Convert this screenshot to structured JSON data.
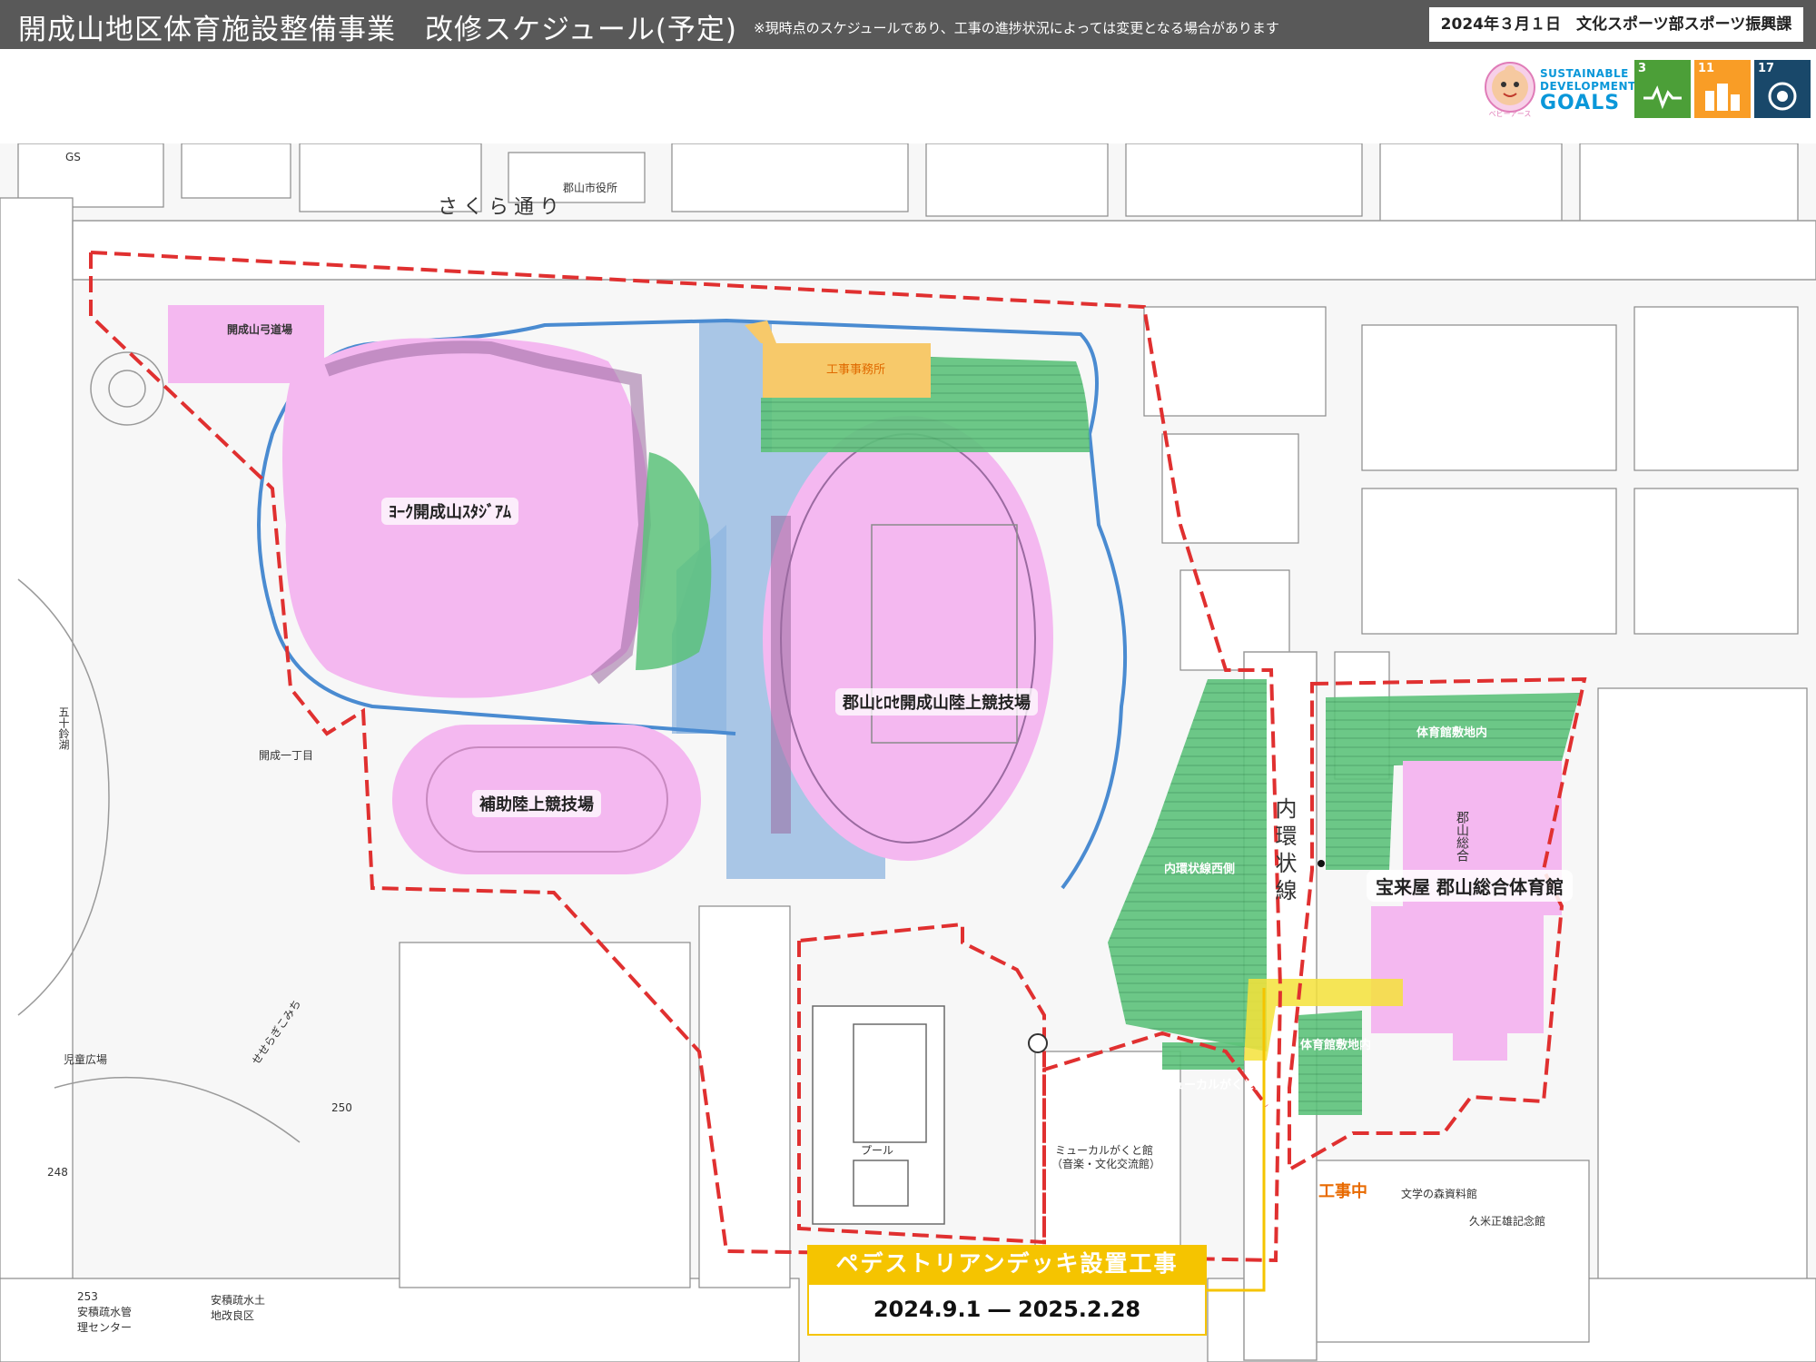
{
  "header": {
    "title": "開成山地区体育施設整備事業　改修スケジュール(予定)",
    "note": "※現時点のスケジュールであり、工事の進捗状況によっては変更となる場合があります",
    "date_dept": "2024年３月１日　文化スポーツ部スポーツ振興課"
  },
  "sdgs": {
    "mascot_caption": "ベビーアース",
    "logo_line1": "SUSTAINABLE",
    "logo_line2": "DEVELOPMENT",
    "logo_line3": "GOALS",
    "tiles": [
      {
        "num": "3",
        "color": "#4c9f38",
        "icon": "heartbeat-icon"
      },
      {
        "num": "11",
        "color": "#f99d26",
        "icon": "city-icon"
      },
      {
        "num": "17",
        "color": "#19486a",
        "icon": "partnership-icon"
      }
    ]
  },
  "map": {
    "roads": {
      "sakura": "さくら通り",
      "naikanjo": "内環状線",
      "seseragi": "せせらぎこみち"
    },
    "landmarks": {
      "city_hall": "郡山市役所",
      "gs": "GS",
      "kaiseiyama_1": "開成一丁目",
      "gojyurin": "五十鈴湖",
      "jido": "児童広場",
      "musical": "ミューカルがくと館",
      "musical_sub": "（音楽・文化交流館）",
      "bungaku": "文学の森資料館",
      "kume": "久米正雄記念館",
      "anzen": "安積疏水管理センター",
      "anzen_num": "253",
      "tochikai": "安積疏水土地改良区",
      "n250": "250",
      "n248": "248",
      "pool": "プール"
    },
    "venues": {
      "kyudo": "開成山弓道場",
      "stadium": "ﾖｰｸ開成山ｽﾀｼﾞｱﾑ",
      "rikujo": "郡山ﾋﾛｾ開成山陸上競技場",
      "hojo": "補助陸上競技場",
      "gym": "宝来屋 郡山総合体育館",
      "gym_bldg": "郡山総合"
    },
    "parking": {
      "office": "工事事務所",
      "naikan_west": "内環状線西側",
      "gym_north": "体育館敷地内",
      "gym_south": "体育館敷地内",
      "musical_lot": "ミューカルがくと館"
    },
    "status": {
      "under_construction": "工事中"
    },
    "colors": {
      "venue_pink": "#f4b8f0",
      "parking_green": "#5cc27a",
      "plaza_blue": "#8fb6e0",
      "boundary_red": "#e03030",
      "pedestrian_yellow": "#f5e23a",
      "office_orange": "#f7c96a"
    }
  },
  "pedestrian_deck": {
    "title": "ペデストリアンデッキ設置工事",
    "period": "2024.9.1 ― 2025.2.28"
  }
}
